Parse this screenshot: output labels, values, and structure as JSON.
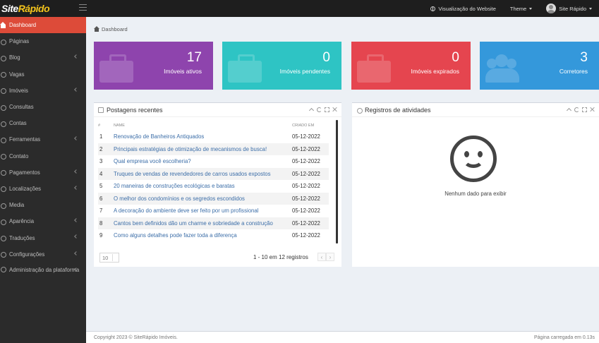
{
  "brand": {
    "part1": "Site",
    "part2": "Rápido"
  },
  "topnav": {
    "view_website": "Visualização do Website",
    "theme": "Theme",
    "user": "Site Rápido"
  },
  "sidebar": {
    "items": [
      {
        "label": "Dashboard",
        "icon": "home-icon",
        "active": true
      },
      {
        "label": "Páginas",
        "icon": "pages-icon"
      },
      {
        "label": "Blog",
        "icon": "edit-icon",
        "submenu": true
      },
      {
        "label": "Vagas",
        "icon": "briefcase-icon"
      },
      {
        "label": "Imóveis",
        "icon": "building-icon",
        "submenu": true
      },
      {
        "label": "Consultas",
        "icon": "chat-icon"
      },
      {
        "label": "Contas",
        "icon": "user-icon"
      },
      {
        "label": "Ferramentas",
        "icon": "wrench-icon",
        "submenu": true
      },
      {
        "label": "Contato",
        "icon": "envelope-icon"
      },
      {
        "label": "Pagamentos",
        "icon": "credit-card-icon",
        "submenu": true
      },
      {
        "label": "Localizações",
        "icon": "globe-icon",
        "submenu": true
      },
      {
        "label": "Media",
        "icon": "image-icon"
      },
      {
        "label": "Aparência",
        "icon": "brush-icon",
        "submenu": true
      },
      {
        "label": "Traduções",
        "icon": "language-icon",
        "submenu": true
      },
      {
        "label": "Configurações",
        "icon": "gear-icon",
        "submenu": true
      },
      {
        "label": "Administração da plataforma",
        "icon": "user-shield-icon",
        "submenu": true
      }
    ]
  },
  "breadcrumb": "Dashboard",
  "stats": [
    {
      "value": "17",
      "caption": "Imóveis ativos",
      "color": "#8e44ad"
    },
    {
      "value": "0",
      "caption": "Imóveis pendentes",
      "color": "#2ec4c4"
    },
    {
      "value": "0",
      "caption": "Imóveis expirados",
      "color": "#e5454f"
    },
    {
      "value": "3",
      "caption": "Corretores",
      "color": "#3498db"
    }
  ],
  "posts_panel": {
    "title": "Postagens recentes",
    "columns": {
      "num": "#",
      "name": "NAME",
      "date": "CRIADO EM"
    },
    "rows": [
      {
        "n": "1",
        "title": "Renovação de Banheiros Antiquados",
        "date": "05-12-2022"
      },
      {
        "n": "2",
        "title": "Principais estratégias de otimização de mecanismos de busca!",
        "date": "05-12-2022"
      },
      {
        "n": "3",
        "title": "Qual empresa você escolheria?",
        "date": "05-12-2022"
      },
      {
        "n": "4",
        "title": "Truques de vendas de revendedores de carros usados expostos",
        "date": "05-12-2022"
      },
      {
        "n": "5",
        "title": "20 maneiras de construções ecológicas e baratas",
        "date": "05-12-2022"
      },
      {
        "n": "6",
        "title": "O melhor dos condomínios e os segredos escondidos",
        "date": "05-12-2022"
      },
      {
        "n": "7",
        "title": "A decoração do ambiente deve ser feito por um profissional",
        "date": "05-12-2022"
      },
      {
        "n": "8",
        "title": "Cantos bem definidos dão um charme e sobriedade a construção",
        "date": "05-12-2022"
      },
      {
        "n": "9",
        "title": "Como alguns detalhes pode fazer toda a diferença",
        "date": "05-12-2022"
      }
    ],
    "per_page": "10",
    "page_info": "1 - 10 em 12 registros",
    "prev": "‹",
    "next": "›"
  },
  "activity_panel": {
    "title": "Registros de atividades",
    "empty_text": "Nenhum dado para exibir"
  },
  "footer": {
    "copyright": "Copyright 2023 © SiteRápido Imóveis.",
    "load_time": "Página carregada em 0.13s"
  },
  "colors": {
    "active_menu": "#dd4b39",
    "sidebar": "#2b2b2b",
    "topbar": "#1e1e1e",
    "link": "#3c6ea8"
  }
}
